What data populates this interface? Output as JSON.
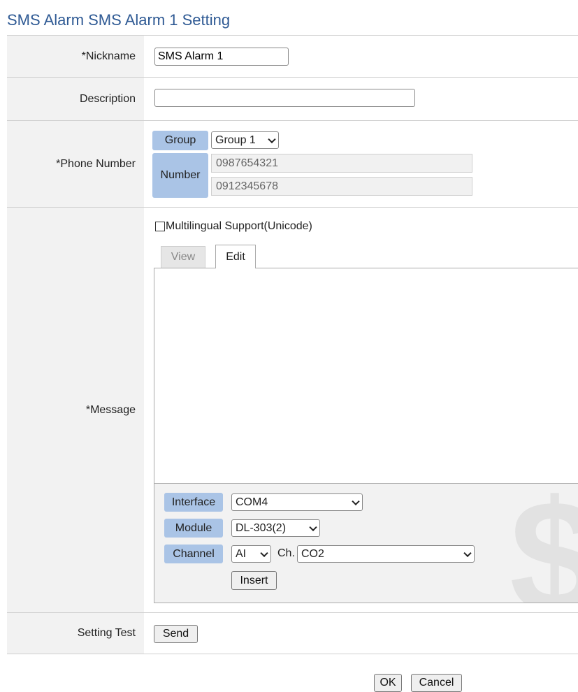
{
  "page": {
    "title": "SMS Alarm SMS Alarm 1 Setting"
  },
  "nickname": {
    "label": "*Nickname",
    "value": "SMS Alarm 1"
  },
  "description": {
    "label": "Description",
    "value": ""
  },
  "phone": {
    "label": "*Phone Number",
    "group_label": "Group",
    "group_value": "Group 1",
    "number_label": "Number",
    "numbers": [
      "0987654321",
      "0912345678"
    ]
  },
  "message": {
    "label": "*Message",
    "multilingual_label": "Multilingual Support(Unicode)",
    "multilingual_checked": false,
    "tabs": [
      "View",
      "Edit"
    ],
    "active_tab": "Edit",
    "content": "",
    "interface_label": "Interface",
    "interface_value": "COM4",
    "module_label": "Module",
    "module_value": "DL-303(2)",
    "channel_label": "Channel",
    "channel_type": "AI",
    "ch_label": "Ch.",
    "channel_value": "CO2",
    "insert_label": "Insert",
    "watermark_glyph": "$"
  },
  "setting_test": {
    "label": "Setting Test",
    "send_label": "Send"
  },
  "footer": {
    "ok_label": "OK",
    "cancel_label": "Cancel"
  },
  "colors": {
    "title": "#2f5a94",
    "pill": "#aac4e6",
    "label_bg": "#f2f2f2"
  }
}
